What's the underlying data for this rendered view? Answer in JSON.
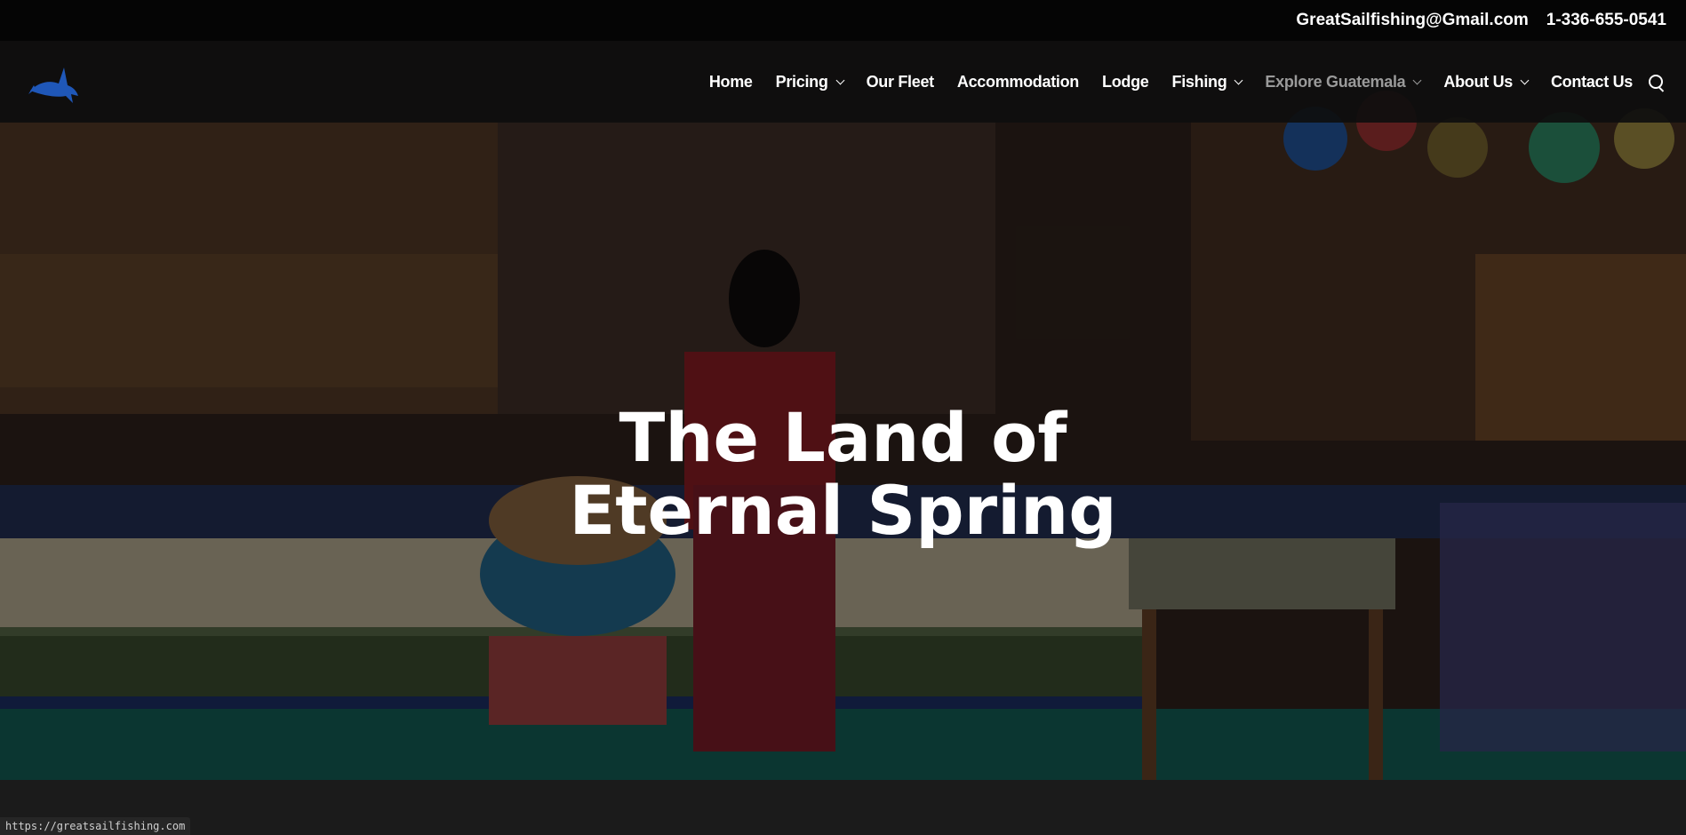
{
  "topbar": {
    "email": "GreatSailfishing@Gmail.com",
    "phone": "1-336-655-0541"
  },
  "nav": {
    "logo_icon": "sailfish-logo-icon",
    "items": [
      {
        "label": "Home",
        "dropdown": false
      },
      {
        "label": "Pricing",
        "dropdown": true
      },
      {
        "label": "Our Fleet",
        "dropdown": false
      },
      {
        "label": "Accommodation",
        "dropdown": false
      },
      {
        "label": "Lodge",
        "dropdown": false
      },
      {
        "label": "Fishing",
        "dropdown": true
      },
      {
        "label": "Explore Guatemala",
        "dropdown": true,
        "active": true
      },
      {
        "label": "About Us",
        "dropdown": true
      },
      {
        "label": "Contact Us",
        "dropdown": false
      }
    ],
    "search_icon": "search-icon"
  },
  "hero": {
    "title": "The Land of Eternal Spring",
    "background": "guatemala-market-photo"
  },
  "status_bar": {
    "url": "https://greatsailfishing.com"
  },
  "colors": {
    "topbar_bg": "#050505",
    "nav_text": "#ffffff",
    "nav_active": "#9a9a9a",
    "logo": "#1f57b8"
  }
}
